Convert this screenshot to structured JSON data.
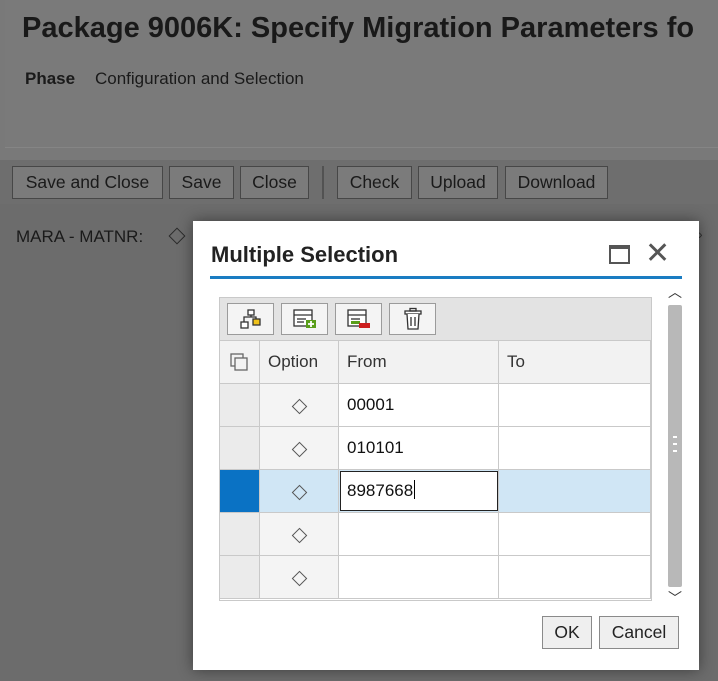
{
  "page": {
    "title": "Package 9006K: Specify Migration Parameters fo",
    "phase_label": "Phase",
    "phase_value": "Configuration and Selection"
  },
  "toolbar": {
    "buttons": [
      "Save and Close",
      "Save",
      "Close",
      "Check",
      "Upload",
      "Download"
    ]
  },
  "field": {
    "label": "MARA - MATNR:"
  },
  "dialog": {
    "title": "Multiple Selection",
    "grid_toolbar_icons": [
      "hierarchy-icon",
      "add-row-icon",
      "delete-row-icon",
      "trash-icon"
    ],
    "columns": {
      "option": "Option",
      "from": "From",
      "to": "To"
    },
    "rows": [
      {
        "from": "00001",
        "to": ""
      },
      {
        "from": "010101",
        "to": ""
      },
      {
        "from": "8987668",
        "to": "",
        "selected": true
      },
      {
        "from": "",
        "to": ""
      },
      {
        "from": "",
        "to": ""
      }
    ],
    "ok_label": "OK",
    "cancel_label": "Cancel"
  },
  "colors": {
    "accent": "#1a7cc2",
    "selection": "#0a72c4",
    "selected_row": "#d0e6f5"
  }
}
